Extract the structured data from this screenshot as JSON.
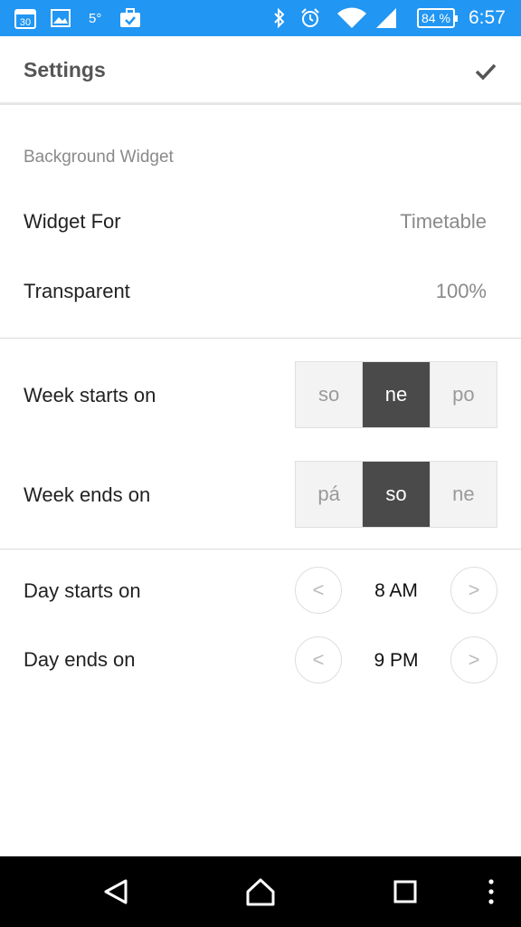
{
  "status_bar": {
    "calendar_day": "30",
    "temperature": "5°",
    "battery": "84 %",
    "time": "6:57",
    "icons": [
      "calendar-icon",
      "image-icon",
      "briefcase-check-icon",
      "bluetooth-icon",
      "alarm-icon",
      "wifi-icon",
      "signal-icon",
      "battery-icon"
    ]
  },
  "header": {
    "title": "Settings",
    "confirm_icon": "check-icon"
  },
  "background_widget": {
    "section_title": "Background Widget",
    "widget_for": {
      "label": "Widget For",
      "value": "Timetable"
    },
    "transparent": {
      "label": "Transparent",
      "value": "100%"
    }
  },
  "week": {
    "starts": {
      "label": "Week starts on",
      "options": [
        "so",
        "ne",
        "po"
      ],
      "selected": "ne"
    },
    "ends": {
      "label": "Week ends on",
      "options": [
        "pá",
        "so",
        "ne"
      ],
      "selected": "so"
    }
  },
  "day": {
    "starts": {
      "label": "Day starts on",
      "prev": "<",
      "value": "8 AM",
      "next": ">"
    },
    "ends": {
      "label": "Day ends on",
      "prev": "<",
      "value": "9 PM",
      "next": ">"
    }
  },
  "nav_bar": {
    "icons": [
      "back-triangle-icon",
      "home-icon",
      "recents-square-icon",
      "more-vert-icon"
    ]
  },
  "colors": {
    "status_bar": "#2196f3",
    "selected_segment": "#4a4a4a",
    "unselected_segment": "#f3f3f3",
    "nav_bar": "#000000"
  }
}
